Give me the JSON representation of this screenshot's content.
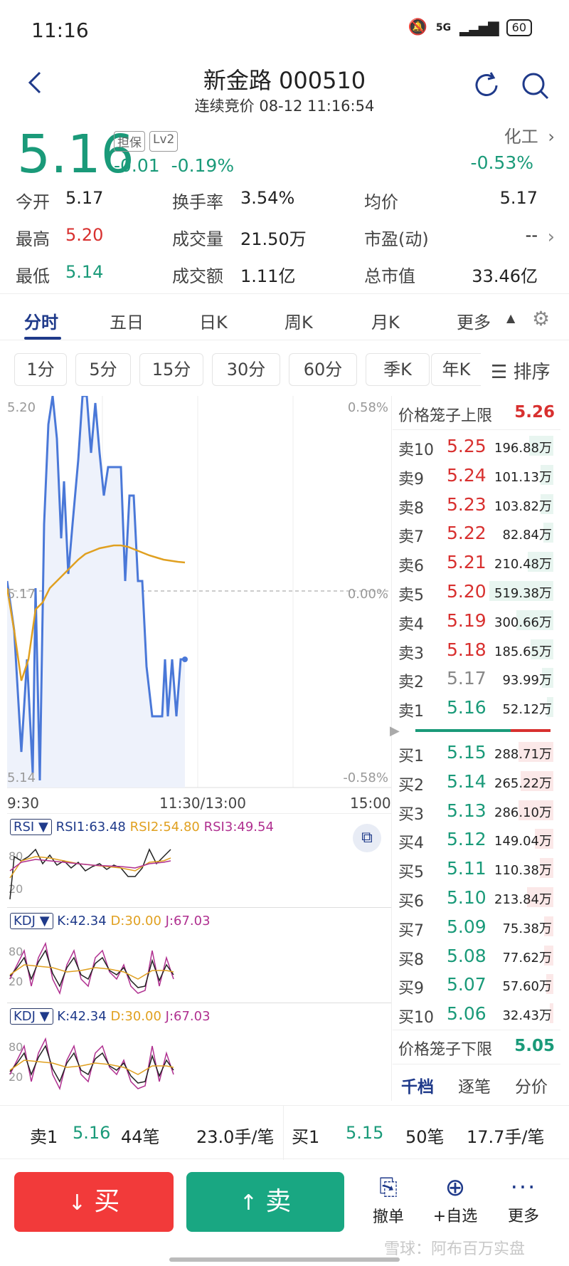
{
  "status_bar": {
    "time": "11:16",
    "network": "5G",
    "battery": "60"
  },
  "header": {
    "title": "新金路 000510",
    "subtitle": "连续竞价 08-12 11:16:54"
  },
  "quote": {
    "price": "5.16",
    "change": "-0.01",
    "change_pct": "-0.19%",
    "tag1": "担保",
    "tag2": "Lv2",
    "sector": "化工",
    "sector_change": "-0.53%",
    "stats": [
      {
        "label": "今开",
        "value": "5.17"
      },
      {
        "label": "换手率",
        "value": "3.54%"
      },
      {
        "label": "均价",
        "value": "5.17"
      },
      {
        "label": "最高",
        "value": "5.20"
      },
      {
        "label": "成交量",
        "value": "21.50万"
      },
      {
        "label": "市盈(动)",
        "value": "--"
      },
      {
        "label": "最低",
        "value": "5.14"
      },
      {
        "label": "成交额",
        "value": "1.11亿"
      },
      {
        "label": "总市值",
        "value": "33.46亿"
      }
    ]
  },
  "tabs": [
    "分时",
    "五日",
    "日K",
    "周K",
    "月K",
    "更多"
  ],
  "period_tabs": [
    "1分",
    "5分",
    "15分",
    "30分",
    "60分",
    "季K",
    "年K"
  ],
  "sort_label": "排序",
  "chart_labels": {
    "high": "5.20",
    "mid": "5.17",
    "low": "5.14",
    "high_pct": "0.58%",
    "mid_pct": "0.00%",
    "low_pct": "-0.58%",
    "t_start": "9:30",
    "t_mid": "11:30/13:00",
    "t_end": "15:00"
  },
  "indicators": {
    "rsi": {
      "name": "RSI",
      "v1": "RSI1:63.48",
      "v2": "RSI2:54.80",
      "v3": "RSI3:49.54",
      "tick_high": "80",
      "tick_low": "20"
    },
    "kdj1": {
      "name": "KDJ",
      "k": "K:42.34",
      "d": "D:30.00",
      "j": "J:67.03",
      "tick_high": "80",
      "tick_low": "20"
    },
    "kdj2": {
      "name": "KDJ",
      "k": "K:42.34",
      "d": "D:30.00",
      "j": "J:67.03",
      "tick_high": "80",
      "tick_low": "20"
    }
  },
  "orderbook": {
    "upper_limit_label": "价格笼子上限",
    "upper_limit": "5.26",
    "lower_limit_label": "价格笼子下限",
    "lower_limit": "5.05",
    "sells": [
      {
        "label": "卖10",
        "price": "5.25",
        "vol": "196.88万",
        "frac": 0.38
      },
      {
        "label": "卖9",
        "price": "5.24",
        "vol": "101.13万",
        "frac": 0.2
      },
      {
        "label": "卖8",
        "price": "5.23",
        "vol": "103.82万",
        "frac": 0.2
      },
      {
        "label": "卖7",
        "price": "5.22",
        "vol": "82.84万",
        "frac": 0.16
      },
      {
        "label": "卖6",
        "price": "5.21",
        "vol": "210.48万",
        "frac": 0.4
      },
      {
        "label": "卖5",
        "price": "5.20",
        "vol": "519.38万",
        "frac": 1.0
      },
      {
        "label": "卖4",
        "price": "5.19",
        "vol": "300.66万",
        "frac": 0.58
      },
      {
        "label": "卖3",
        "price": "5.18",
        "vol": "185.65万",
        "frac": 0.36
      },
      {
        "label": "卖2",
        "price": "5.17",
        "vol": "93.99万",
        "frac": 0.18
      },
      {
        "label": "卖1",
        "price": "5.16",
        "vol": "52.12万",
        "frac": 0.1
      }
    ],
    "buys": [
      {
        "label": "买1",
        "price": "5.15",
        "vol": "288.71万",
        "frac": 0.55
      },
      {
        "label": "买2",
        "price": "5.14",
        "vol": "265.22万",
        "frac": 0.51
      },
      {
        "label": "买3",
        "price": "5.13",
        "vol": "286.10万",
        "frac": 0.55
      },
      {
        "label": "买4",
        "price": "5.12",
        "vol": "149.04万",
        "frac": 0.29
      },
      {
        "label": "买5",
        "price": "5.11",
        "vol": "110.38万",
        "frac": 0.21
      },
      {
        "label": "买6",
        "price": "5.10",
        "vol": "213.84万",
        "frac": 0.41
      },
      {
        "label": "买7",
        "price": "5.09",
        "vol": "75.38万",
        "frac": 0.14
      },
      {
        "label": "买8",
        "price": "5.08",
        "vol": "77.62万",
        "frac": 0.15
      },
      {
        "label": "买9",
        "price": "5.07",
        "vol": "57.60万",
        "frac": 0.11
      },
      {
        "label": "买10",
        "price": "5.06",
        "vol": "32.43万",
        "frac": 0.06
      }
    ],
    "tabs": [
      "千档",
      "逐笔",
      "分价"
    ]
  },
  "trade_summary": {
    "sell_label": "卖1",
    "sell_price": "5.16",
    "sell_count": "44笔",
    "sell_avg": "23.0手/笔",
    "buy_label": "买1",
    "buy_price": "5.15",
    "buy_count": "50笔",
    "buy_avg": "17.7手/笔"
  },
  "actions": {
    "buy": "买",
    "sell": "卖",
    "cancel": "撤单",
    "watch": "+自选",
    "more": "更多"
  },
  "watermark": "雪球：阿布百万实盘",
  "colors": {
    "red": "#d8302f",
    "green": "#1a9a79",
    "buy_button": "#f23a3a",
    "sell_button": "#19a782",
    "price_line": "#4a78d8",
    "avg_line": "#e0a020"
  }
}
